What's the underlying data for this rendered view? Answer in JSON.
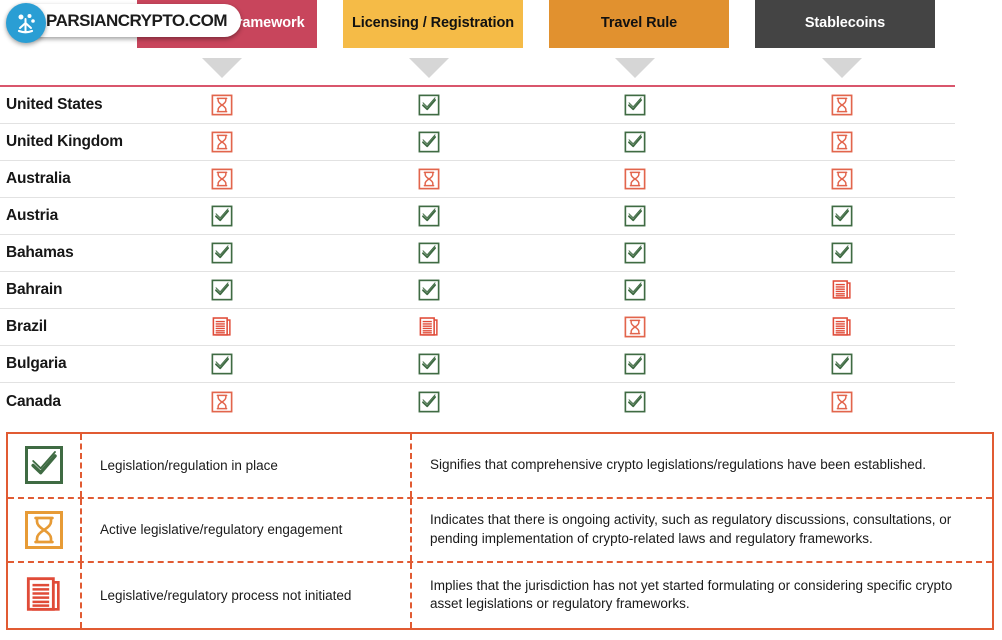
{
  "watermark": {
    "text": "PARSIANCRYPTO.COM",
    "logo_color": "#2a9ed4"
  },
  "columns": [
    {
      "label": "Regulatory Framework",
      "color": "#c8455c",
      "text_color": "#ffffff"
    },
    {
      "label": "Licensing / Registration",
      "color": "#f5bb47",
      "text_color": "#111111"
    },
    {
      "label": "Travel Rule",
      "color": "#e1912f",
      "text_color": "#111111"
    },
    {
      "label": "Stablecoins",
      "color": "#444444",
      "text_color": "#ffffff"
    }
  ],
  "rows": [
    {
      "country": "United States",
      "status": [
        "hourglass",
        "check",
        "check",
        "hourglass"
      ]
    },
    {
      "country": "United Kingdom",
      "status": [
        "hourglass",
        "check",
        "check",
        "hourglass"
      ]
    },
    {
      "country": "Australia",
      "status": [
        "hourglass",
        "hourglass",
        "hourglass",
        "hourglass"
      ]
    },
    {
      "country": "Austria",
      "status": [
        "check",
        "check",
        "check",
        "check"
      ]
    },
    {
      "country": "Bahamas",
      "status": [
        "check",
        "check",
        "check",
        "check"
      ]
    },
    {
      "country": "Bahrain",
      "status": [
        "check",
        "check",
        "check",
        "document"
      ]
    },
    {
      "country": "Brazil",
      "status": [
        "document",
        "document",
        "hourglass",
        "document"
      ]
    },
    {
      "country": "Bulgaria",
      "status": [
        "check",
        "check",
        "check",
        "check"
      ]
    },
    {
      "country": "Canada",
      "status": [
        "hourglass",
        "check",
        "check",
        "hourglass"
      ]
    }
  ],
  "legend": {
    "items": [
      {
        "icon": "check",
        "label": "Legislation/regulation in place",
        "description": "Signifies that comprehensive crypto legislations/regulations have been established."
      },
      {
        "icon": "hourglass",
        "label": "Active legislative/regulatory engagement",
        "description": "Indicates that there is ongoing activity, such as regulatory discussions, consultations, or pending implementation of crypto-related laws and regulatory frameworks."
      },
      {
        "icon": "document",
        "label": "Legislative/regulatory process not initiated",
        "description": "Implies that the jurisdiction has not yet started formulating or considering specific crypto asset legislations or regulatory frameworks."
      }
    ],
    "border_color": "#e15b33"
  },
  "colors": {
    "check_green": "#3f6b43",
    "hourglass_red": "#e2654c",
    "hourglass_orange": "#e79b36",
    "document_red": "#e04b38",
    "rule_pink": "#d9566c",
    "row_divider": "#e2e2e2",
    "arrow_gray": "#d6d6d6"
  }
}
